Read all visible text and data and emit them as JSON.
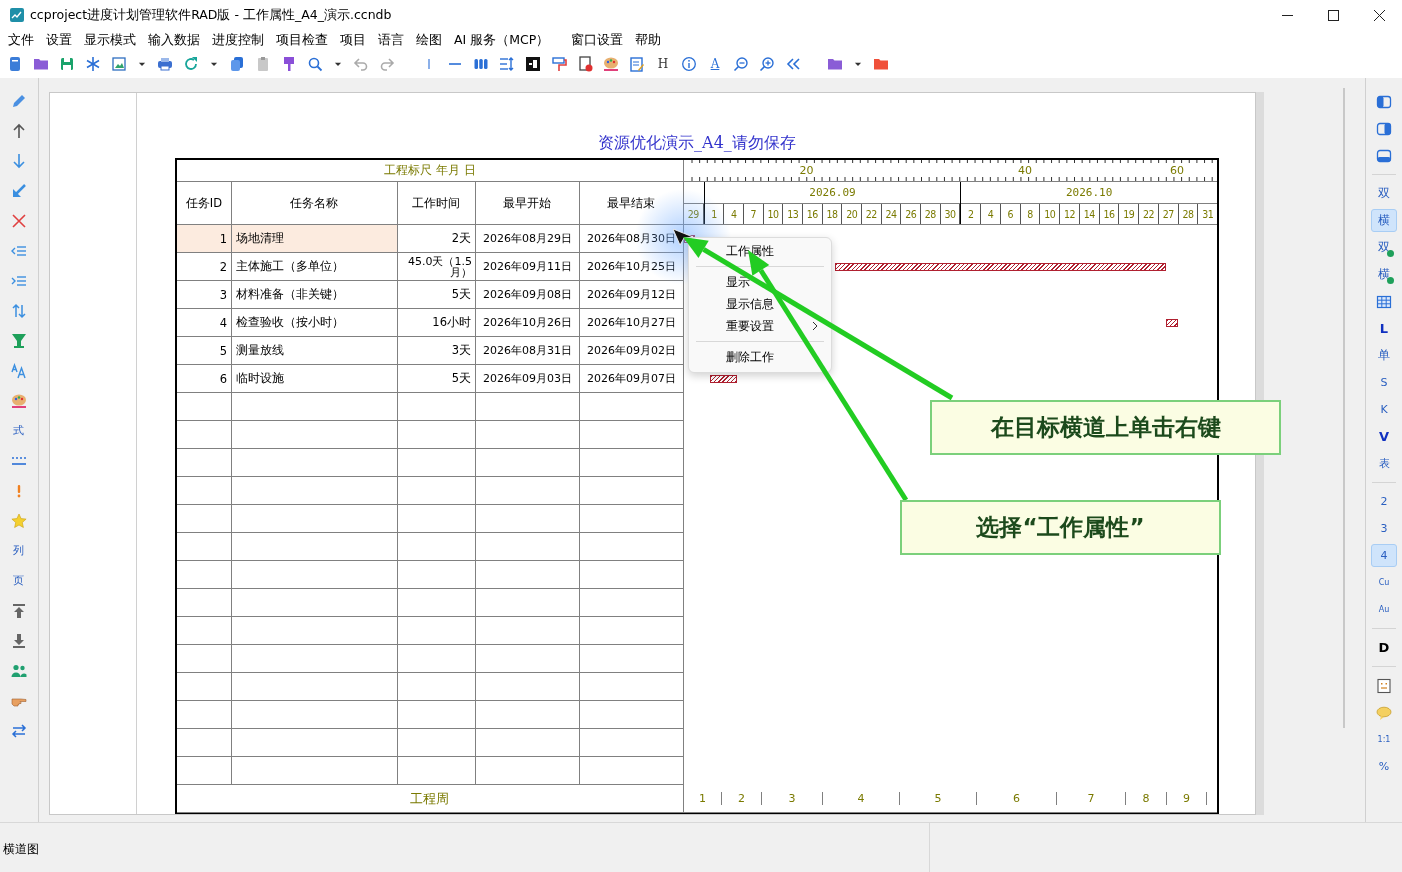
{
  "window": {
    "title": "ccproject进度计划管理软件RAD版 - 工作属性_A4_演示.ccndb"
  },
  "menu": [
    "文件",
    "设置",
    "显示模式",
    "输入数据",
    "进度控制",
    "项目检查",
    "项目",
    "语言",
    "绘图",
    "AI 服务（MCP）",
    "窗口设置",
    "帮助"
  ],
  "toolbar_labels": [
    {
      "label": "H",
      "kind": "plain"
    },
    {
      "label": "A",
      "kind": "underlined"
    }
  ],
  "left_toolbar_labels": [
    "式",
    "列",
    "页"
  ],
  "right_toolbar": [
    {
      "label": "双",
      "kind": "plain",
      "selected": false
    },
    {
      "label": "横",
      "kind": "plain",
      "selected": true
    },
    {
      "label": "双",
      "kind": "badged",
      "selected": false
    },
    {
      "label": "横",
      "kind": "badged",
      "selected": false
    },
    {
      "label": "L",
      "kind": "bold",
      "selected": false
    },
    {
      "label": "单",
      "kind": "plain",
      "selected": false
    },
    {
      "label": "S",
      "kind": "small",
      "selected": false
    },
    {
      "label": "K",
      "kind": "small",
      "selected": false
    },
    {
      "label": "V",
      "kind": "bold",
      "selected": false
    },
    {
      "label": "表",
      "kind": "small",
      "selected": false
    },
    {
      "label": "2",
      "kind": "small",
      "selected": false
    },
    {
      "label": "3",
      "kind": "small",
      "selected": false
    },
    {
      "label": "4",
      "kind": "small",
      "selected": true
    },
    {
      "label": "Cu",
      "kind": "tiny",
      "selected": false
    },
    {
      "label": "Au",
      "kind": "tiny",
      "selected": false
    },
    {
      "label": "D",
      "kind": "black",
      "selected": false
    },
    {
      "label": "1:1",
      "kind": "tiny",
      "selected": false
    },
    {
      "label": "%",
      "kind": "small",
      "selected": false
    }
  ],
  "document": {
    "title": "资源优化演示_A4_请勿保存",
    "scale_label": "工程标尺 年月 日",
    "ruler_labels": [
      "20",
      "40",
      "60"
    ],
    "columns": [
      "任务ID",
      "任务名称",
      "工作时间",
      "最早开始",
      "最早结束"
    ],
    "months": [
      {
        "days": [
          "29"
        ]
      },
      {
        "label": "2026.09",
        "days": [
          "1",
          "4",
          "7",
          "10",
          "13",
          "16",
          "18",
          "20",
          "22",
          "24",
          "26",
          "28",
          "30"
        ]
      },
      {
        "label": "2026.10",
        "days": [
          "2",
          "4",
          "6",
          "8",
          "10",
          "12",
          "14",
          "16",
          "19",
          "22",
          "27",
          "28",
          "31"
        ]
      }
    ],
    "rows": [
      {
        "id": "1",
        "name": "场地清理",
        "duration": "2天",
        "start": "2026年08月29日",
        "end": "2026年08月30日",
        "selected": true
      },
      {
        "id": "2",
        "name": "主体施工（多单位）",
        "duration": "45.0天（1.5月）",
        "start": "2026年09月11日",
        "end": "2026年10月25日",
        "selected": false
      },
      {
        "id": "3",
        "name": "材料准备（非关键）",
        "duration": "5天",
        "start": "2026年09月08日",
        "end": "2026年09月12日",
        "selected": false
      },
      {
        "id": "4",
        "name": "检查验收（按小时）",
        "duration": "16小时",
        "start": "2026年10月26日",
        "end": "2026年10月27日",
        "selected": false
      },
      {
        "id": "5",
        "name": "测量放线",
        "duration": "3天",
        "start": "2026年08月31日",
        "end": "2026年09月02日",
        "selected": false
      },
      {
        "id": "6",
        "name": "临时设施",
        "duration": "5天",
        "start": "2026年09月03日",
        "end": "2026年09月07日",
        "selected": false
      }
    ],
    "week_label": "工程周",
    "weeks": [
      "1",
      "2",
      "3",
      "4",
      "5",
      "6",
      "7",
      "8",
      "9"
    ]
  },
  "context_menu": [
    {
      "kind": "item",
      "label": "工作属性"
    },
    {
      "kind": "separator"
    },
    {
      "kind": "item",
      "label": "显示"
    },
    {
      "kind": "item",
      "label": "显示信息"
    },
    {
      "kind": "submenu",
      "label": "重要设置"
    },
    {
      "kind": "separator"
    },
    {
      "kind": "item",
      "label": "删除工作"
    }
  ],
  "callouts": [
    "在目标横道上单击右键",
    "选择“工作属性”"
  ],
  "status_bar": {
    "text": "横道图"
  }
}
